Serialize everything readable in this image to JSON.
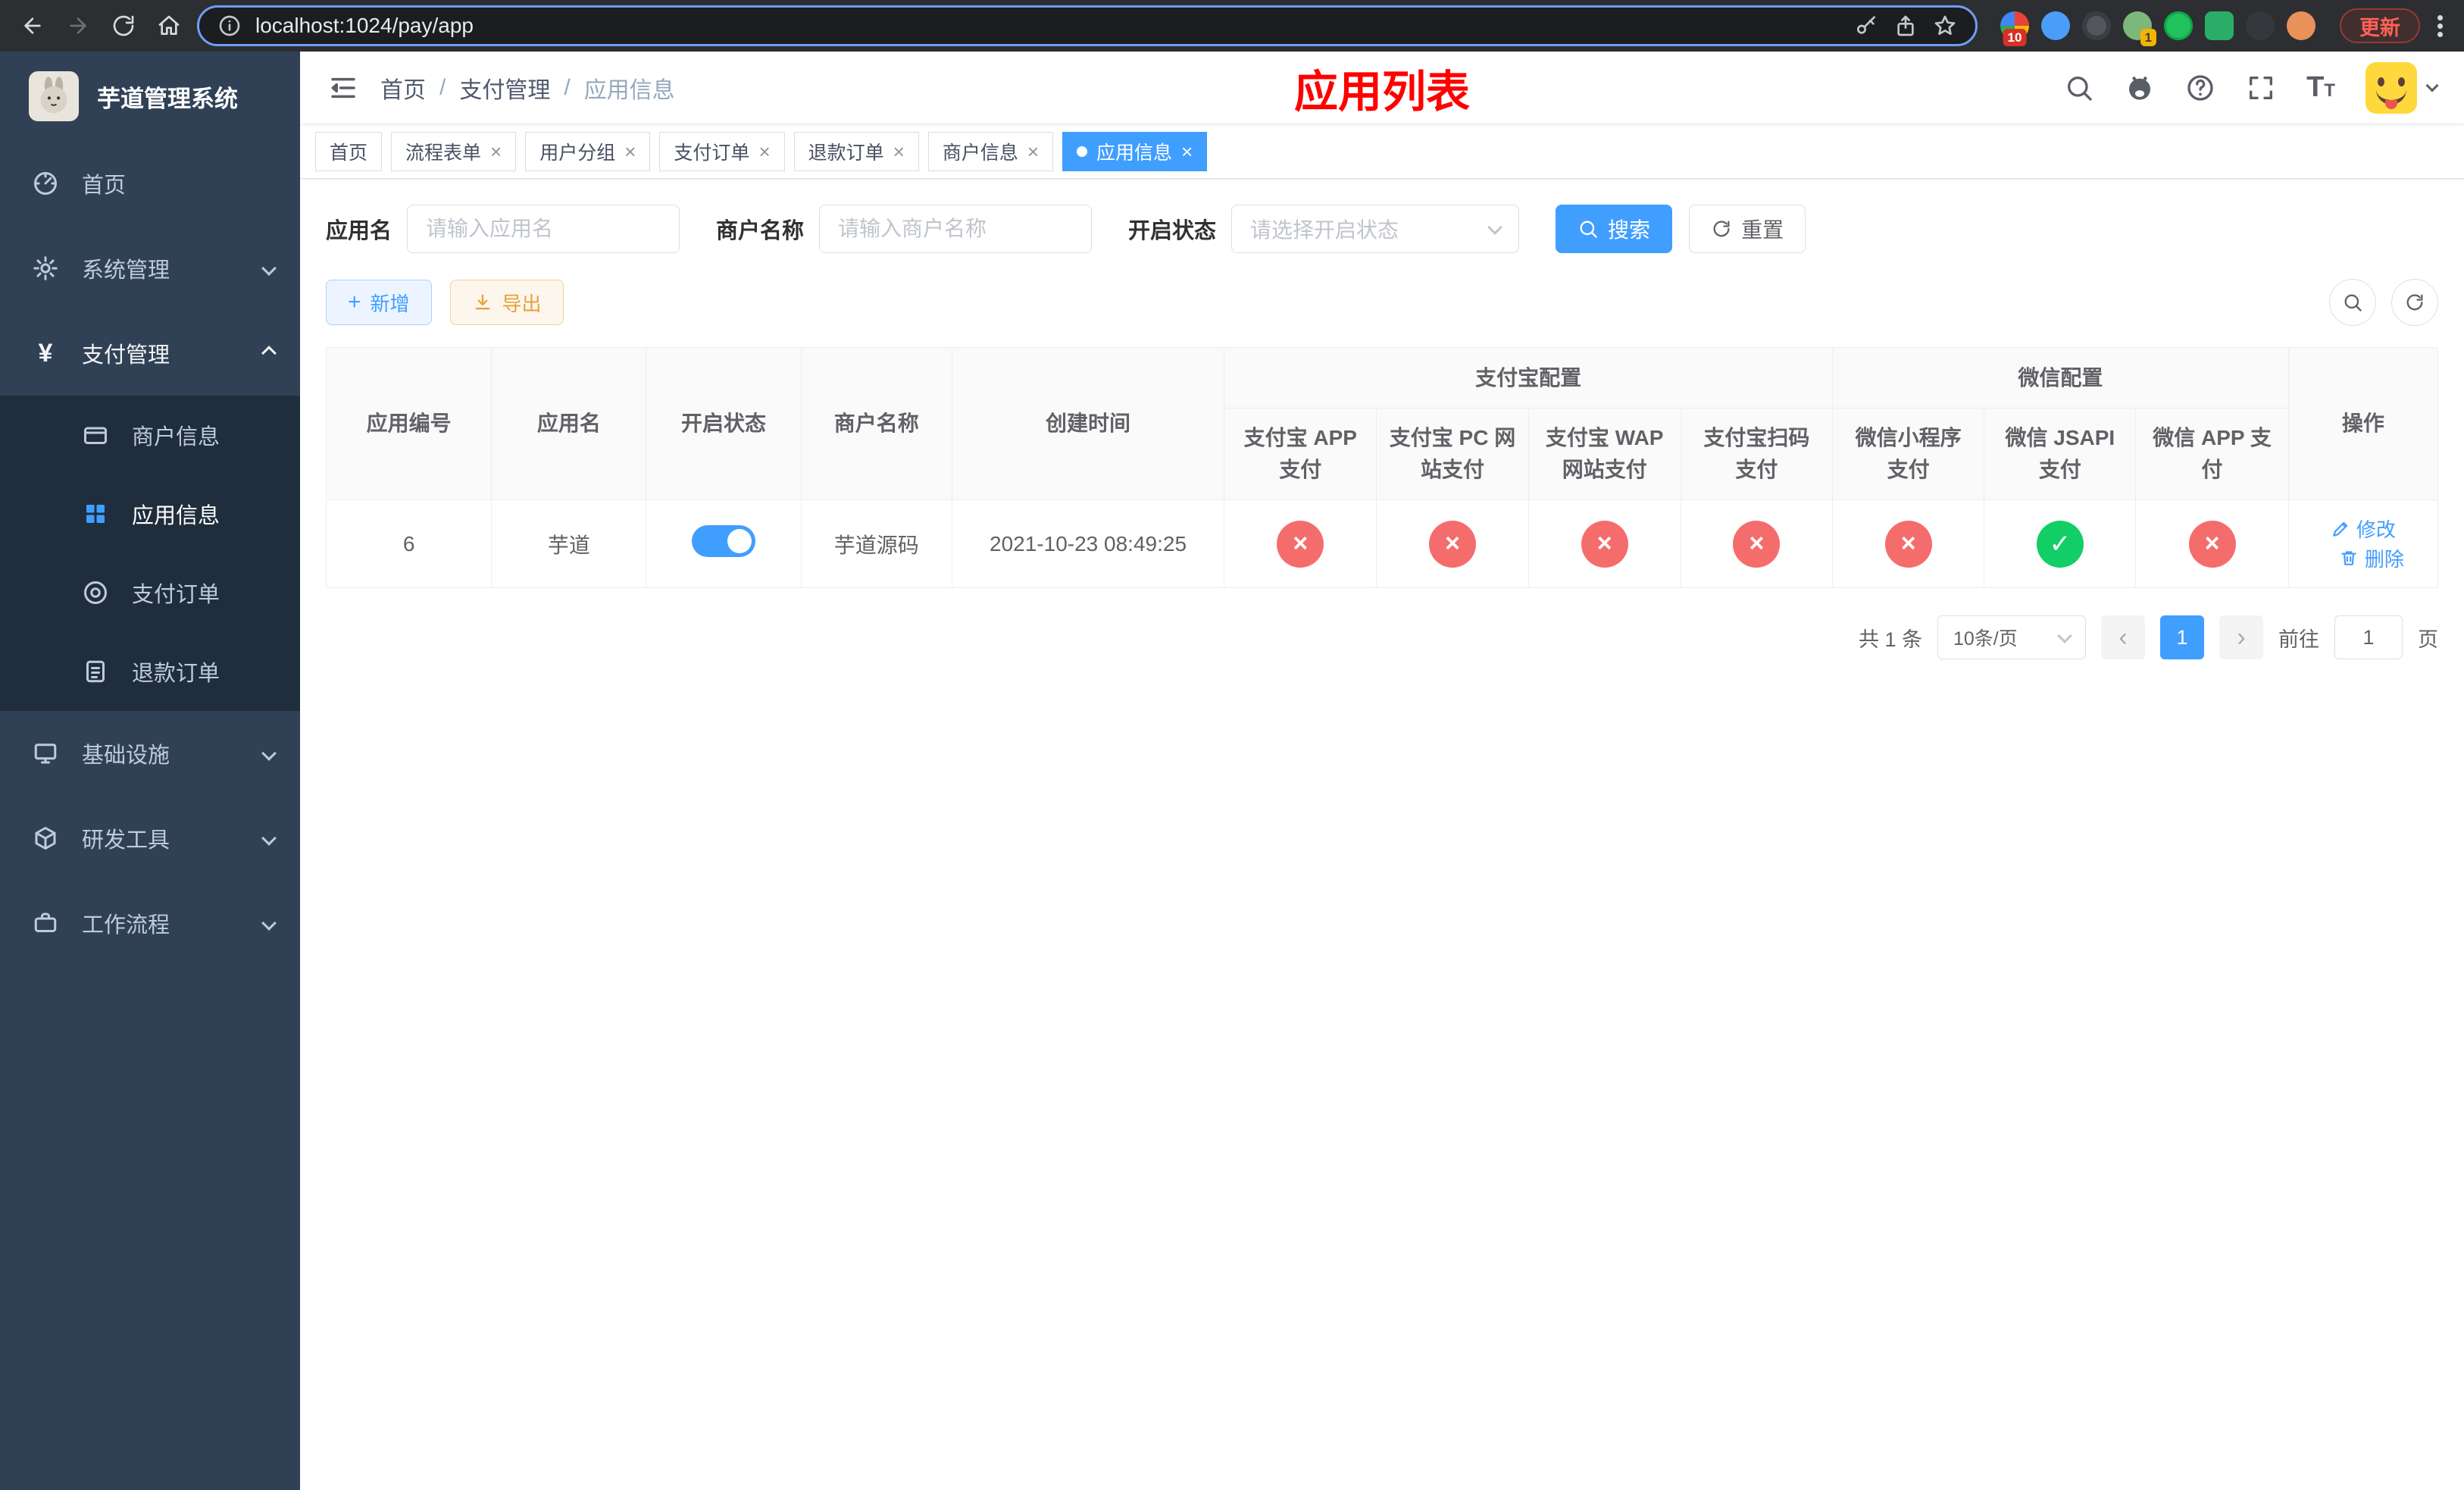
{
  "browser": {
    "url": "localhost:1024/pay/app",
    "update_label": "更新",
    "ext_badge_1": "10",
    "ext_badge_2": "1"
  },
  "sidebar": {
    "logo_title": "芋道管理系统",
    "items": [
      {
        "label": "首页"
      },
      {
        "label": "系统管理"
      },
      {
        "label": "支付管理"
      },
      {
        "label": "基础设施"
      },
      {
        "label": "研发工具"
      },
      {
        "label": "工作流程"
      }
    ],
    "submenu": [
      {
        "label": "商户信息"
      },
      {
        "label": "应用信息"
      },
      {
        "label": "支付订单"
      },
      {
        "label": "退款订单"
      }
    ]
  },
  "header": {
    "breadcrumb": {
      "home": "首页",
      "section": "支付管理",
      "current": "应用信息"
    },
    "page_title": "应用列表"
  },
  "tabs": [
    {
      "label": "首页"
    },
    {
      "label": "流程表单"
    },
    {
      "label": "用户分组"
    },
    {
      "label": "支付订单"
    },
    {
      "label": "退款订单"
    },
    {
      "label": "商户信息"
    },
    {
      "label": "应用信息"
    }
  ],
  "filters": {
    "app_name_label": "应用名",
    "app_name_placeholder": "请输入应用名",
    "merchant_label": "商户名称",
    "merchant_placeholder": "请输入商户名称",
    "status_label": "开启状态",
    "status_placeholder": "请选择开启状态",
    "search_label": "搜索",
    "reset_label": "重置"
  },
  "toolbar": {
    "add_label": "新增",
    "export_label": "导出"
  },
  "table": {
    "col_app_id": "应用编号",
    "col_app_name": "应用名",
    "col_status": "开启状态",
    "col_merchant": "商户名称",
    "col_created": "创建时间",
    "group_alipay": "支付宝配置",
    "group_wechat": "微信配置",
    "col_alipay_app": "支付宝 APP 支付",
    "col_alipay_pc": "支付宝 PC 网站支付",
    "col_alipay_wap": "支付宝 WAP 网站支付",
    "col_alipay_qr": "支付宝扫码支付",
    "col_wx_mini": "微信小程序支付",
    "col_wx_jsapi": "微信 JSAPI 支付",
    "col_wx_app": "微信 APP 支付",
    "col_actions": "操作",
    "row": {
      "id": "6",
      "name": "芋道",
      "status_on": true,
      "merchant": "芋道源码",
      "created": "2021-10-23 08:49:25"
    },
    "actions": {
      "edit": "修改",
      "delete": "删除"
    }
  },
  "pagination": {
    "total": "共 1 条",
    "size": "10条/页",
    "page": "1",
    "goto": "前往",
    "goto_value": "1",
    "unit": "页"
  },
  "icons": {
    "close": "×",
    "cross": "×",
    "check": "✓",
    "plus": "+",
    "prev": "‹",
    "next": "›",
    "text_big": "T",
    "text_small": "T"
  },
  "colors": {
    "primary": "#409eff",
    "danger": "#f56c6c",
    "success": "#13ce66",
    "title": "#ff0000",
    "sidebar_bg": "#304156",
    "submenu_bg": "#1f2d3d"
  }
}
